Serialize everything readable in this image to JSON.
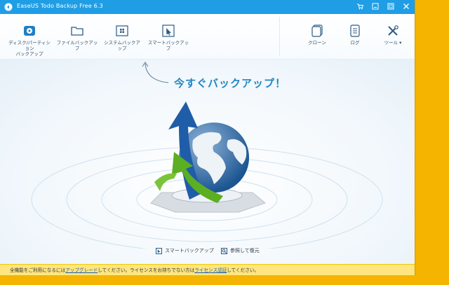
{
  "window": {
    "title": "EaseUS Todo Backup Free 6.3"
  },
  "toolbar": {
    "disk_partition_backup": "ディスク/パーティション\nバックアップ",
    "file_backup": "ファイルバックアップ",
    "system_backup": "システムバックアップ",
    "smart_backup": "スマートバックアップ",
    "clone": "クローン",
    "log": "ログ",
    "tools": "ツール"
  },
  "main": {
    "headline": "今すぐバックアップ！",
    "smart_backup_link": "スマートバックアップ",
    "browse_restore_link": "参照して復元"
  },
  "statusbar": {
    "text_1": "全機能をご利用になるには",
    "upgrade_link": "アップグレード",
    "text_2": "してください。ライセンスをお持ちでない方は",
    "license_link": "ライセンス認証",
    "text_3": "してください。"
  },
  "colors": {
    "titlebar": "#1f9ee6",
    "desktop": "#f4b400",
    "headline": "#1f86c3",
    "statusbar": "#ffe680"
  }
}
